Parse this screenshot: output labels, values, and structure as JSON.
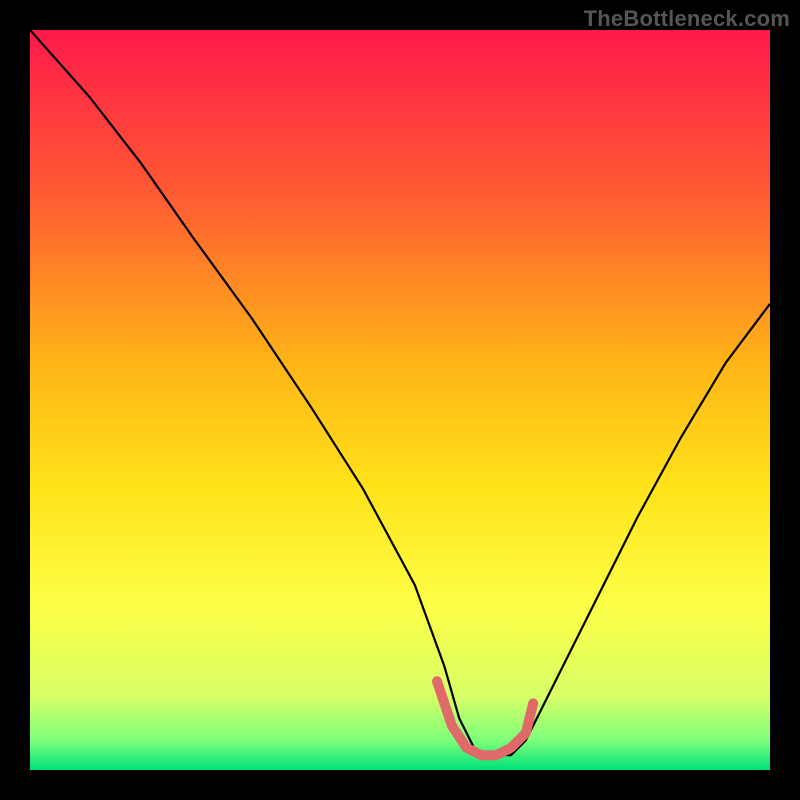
{
  "watermark": {
    "text": "TheBottleneck.com"
  },
  "chart_data": {
    "type": "line",
    "title": "",
    "xlabel": "",
    "ylabel": "",
    "xlim": [
      0,
      100
    ],
    "ylim": [
      0,
      100
    ],
    "grid": false,
    "legend": false,
    "background_gradient_stops": [
      {
        "offset": 0.0,
        "color": "#ff1a4b"
      },
      {
        "offset": 0.22,
        "color": "#ff5a33"
      },
      {
        "offset": 0.45,
        "color": "#ffb417"
      },
      {
        "offset": 0.62,
        "color": "#ffe31a"
      },
      {
        "offset": 0.78,
        "color": "#fdff47"
      },
      {
        "offset": 0.9,
        "color": "#d7ff66"
      },
      {
        "offset": 0.96,
        "color": "#7dff7a"
      },
      {
        "offset": 1.0,
        "color": "#00e07a"
      }
    ],
    "series": [
      {
        "name": "bottleneck-curve",
        "stroke": "#000000",
        "stroke_width": 2.2,
        "x": [
          0,
          8,
          15,
          22,
          30,
          38,
          45,
          52,
          56,
          58,
          60,
          62,
          65,
          67,
          70,
          76,
          82,
          88,
          94,
          100
        ],
        "y": [
          100,
          91,
          82,
          72,
          61,
          49,
          38,
          25,
          14,
          7,
          3,
          2,
          2,
          4,
          10,
          22,
          34,
          45,
          55,
          63
        ]
      },
      {
        "name": "optimal-zone",
        "stroke": "#e06a6a",
        "stroke_width": 10,
        "linecap": "round",
        "x": [
          55,
          57,
          59,
          61,
          63,
          65,
          67,
          68
        ],
        "y": [
          12,
          6,
          3,
          2,
          2,
          3,
          5,
          9
        ]
      }
    ]
  }
}
